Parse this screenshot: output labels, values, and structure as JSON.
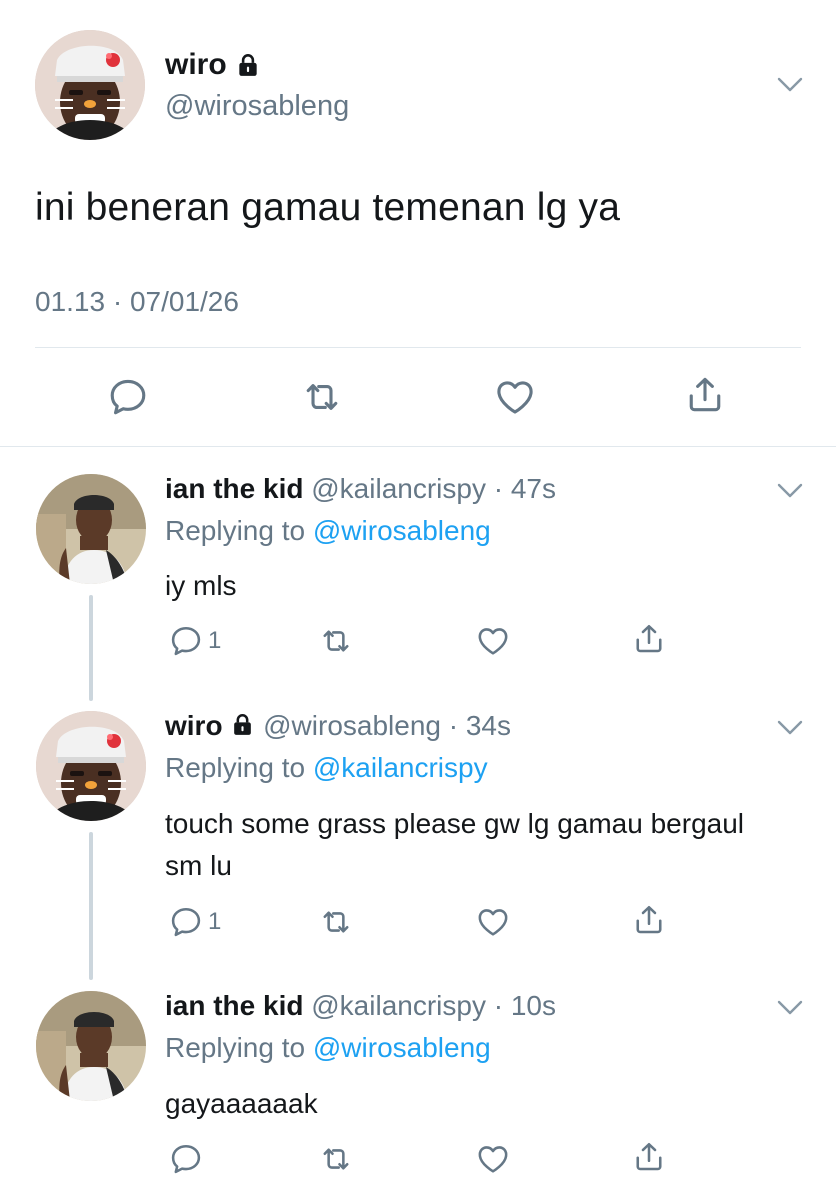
{
  "main_tweet": {
    "name": "wiro",
    "handle": "@wirosableng",
    "text": "ini beneran gamau temenan lg ya",
    "timestamp": "01.13 · 07/01/26",
    "icons": [
      "lock-icon",
      "chevron-down-icon",
      "reply-icon",
      "retweet-icon",
      "like-icon",
      "share-icon"
    ]
  },
  "replies": [
    {
      "name": "ian the kid",
      "handle": "@kailancrispy",
      "time": "· 47s",
      "replying_prefix": "Replying to ",
      "replying_to": "@wirosableng",
      "text": "iy mls",
      "reply_count": "1"
    },
    {
      "name": "wiro",
      "handle": "@wirosableng",
      "time": "· 34s",
      "replying_prefix": "Replying to ",
      "replying_to": "@kailancrispy",
      "text": "touch some grass please gw lg gamau bergaul sm lu",
      "reply_count": "1"
    },
    {
      "name": "ian the kid",
      "handle": "@kailancrispy",
      "time": "· 10s",
      "replying_prefix": "Replying to ",
      "replying_to": "@wirosableng",
      "text": "gayaaaaaak",
      "reply_count": ""
    }
  ],
  "colors": {
    "text": "#14171a",
    "secondary": "#657786",
    "link": "#1da1f2",
    "divider": "#e1e8ed",
    "thread_line": "#ccd6dd"
  }
}
